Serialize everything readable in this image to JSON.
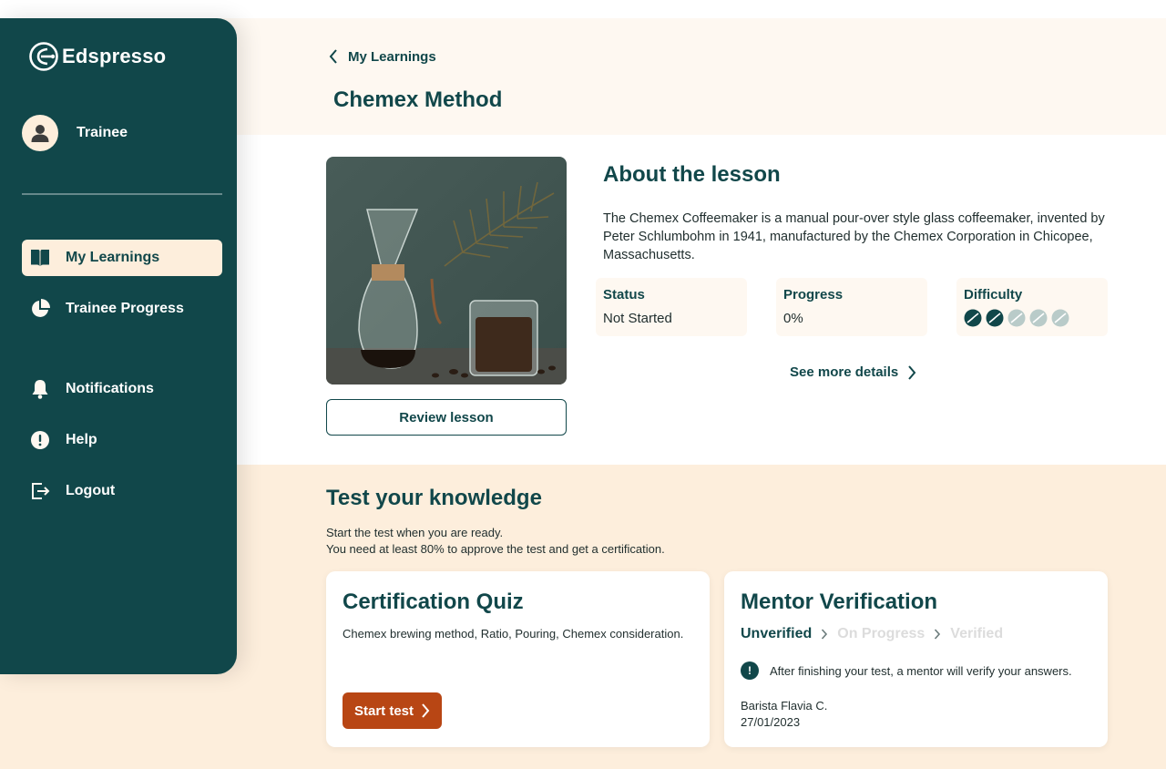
{
  "app": {
    "name": "Edspresso"
  },
  "profile": {
    "name": "Trainee"
  },
  "sidebar": {
    "items": [
      {
        "label": "My Learnings",
        "icon": "book-icon",
        "active": true
      },
      {
        "label": "Trainee Progress",
        "icon": "pie-chart-icon"
      },
      {
        "label": "Notifications",
        "icon": "bell-icon"
      },
      {
        "label": "Help",
        "icon": "alert-circle-icon"
      },
      {
        "label": "Logout",
        "icon": "logout-icon"
      }
    ]
  },
  "header": {
    "breadcrumb": "My Learnings",
    "title": "Chemex Method"
  },
  "lesson": {
    "image_alt": "Chemex coffeemaker and glass of coffee",
    "review_button": "Review lesson",
    "about_title": "About the lesson",
    "description": "The Chemex Coffeemaker is a manual pour-over style glass coffeemaker, invented by Peter Schlumbohm in 1941, manufactured by the Chemex Corporation in Chicopee, Massachusetts.",
    "status": {
      "label": "Status",
      "value": "Not Started"
    },
    "progress": {
      "label": "Progress",
      "value": "0%"
    },
    "difficulty": {
      "label": "Difficulty",
      "level": 2,
      "max": 5
    },
    "see_more": "See more details"
  },
  "test": {
    "title": "Test your knowledge",
    "desc_line1": "Start the test when you are ready.",
    "desc_line2": "You need at least 80% to approve the test and get a certification.",
    "quiz": {
      "title": "Certification Quiz",
      "topics": "Chemex brewing method, Ratio, Pouring, Chemex consideration.",
      "start_button": "Start test"
    },
    "mentor": {
      "title": "Mentor Verification",
      "steps": [
        "Unverified",
        "On Progress",
        "Verified"
      ],
      "current_step": 0,
      "notice": "After finishing your test, a mentor will verify your answers.",
      "mentor_name": "Barista Flavia C.",
      "date": "27/01/2023"
    }
  },
  "colors": {
    "primary": "#11474a",
    "accent": "#b84614",
    "cream": "#fdeedc",
    "light_cream": "#fef8f1"
  }
}
